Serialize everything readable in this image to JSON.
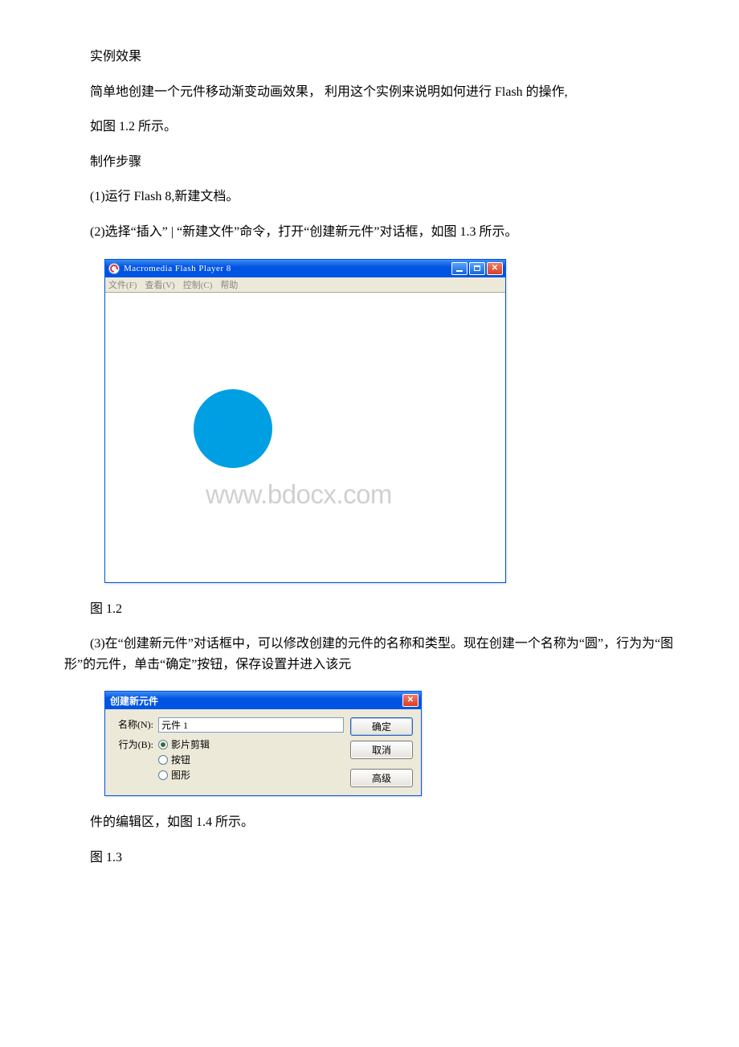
{
  "text": {
    "p1": "实例效果",
    "p2_a": "简单地创建一个元件移动渐变动画效果， 利用这个实例来说明如何进行 Flash 的操作,",
    "p3": "如图 1.2 所示。",
    "p4": "制作步骤",
    "p5": "(1)运行 Flash 8,新建文档。",
    "p6": "(2)选择“插入” | “新建文件”命令，打开“创建新元件”对话框，如图 1.3 所示。",
    "fig12_caption": "图 1.2",
    "p7": "(3)在“创建新元件”对话框中，可以修改创建的元件的名称和类型。现在创建一个名称为“圆”，行为为“图形”的元件，单击“确定”按钮，保存设置并进入该元",
    "p8": "件的编辑区，如图 1.4 所示。",
    "fig13_caption": "图 1.3"
  },
  "flash_player": {
    "title": "Macromedia Flash Player 8",
    "menus": [
      "文件(F)",
      "查看(V)",
      "控制(C)",
      "帮助"
    ],
    "watermark": "www.bdocx.com"
  },
  "dialog": {
    "title": "创建新元件",
    "name_label": "名称(N):",
    "name_value": "元件 1",
    "behavior_label": "行为(B):",
    "options": [
      {
        "label": "影片剪辑",
        "checked": true
      },
      {
        "label": "按钮",
        "checked": false
      },
      {
        "label": "图形",
        "checked": false
      }
    ],
    "buttons": {
      "ok": "确定",
      "cancel": "取消",
      "advanced": "高级"
    }
  }
}
